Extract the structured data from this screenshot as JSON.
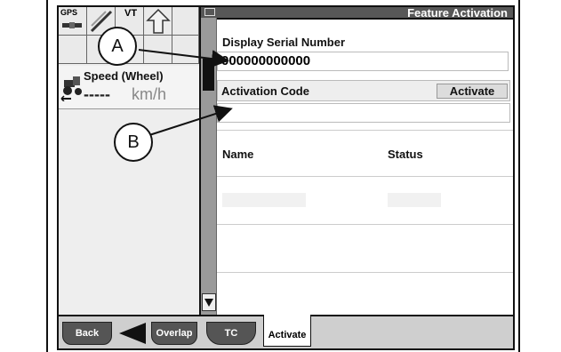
{
  "window": {
    "title": "Feature Activation"
  },
  "status_grid": {
    "gps_label": "GPS",
    "vt_label": "VT"
  },
  "speed": {
    "label": "Speed (Wheel)",
    "value": "-----",
    "unit": "km/h"
  },
  "serial": {
    "label": "Display Serial Number",
    "value": "000000000000"
  },
  "activation": {
    "label": "Activation Code",
    "button_label": "Activate",
    "input_value": ""
  },
  "table": {
    "headers": [
      "Name",
      "Status"
    ]
  },
  "softkeys": {
    "back": "Back",
    "overlap": "Overlap",
    "tc": "TC",
    "activate_tab": "Activate"
  },
  "callouts": {
    "a": "A",
    "b": "B"
  }
}
